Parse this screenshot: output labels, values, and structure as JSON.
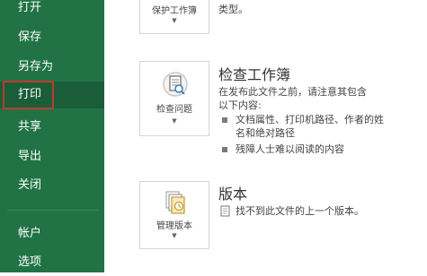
{
  "sidebar": {
    "items": [
      {
        "label": "打开"
      },
      {
        "label": "保存"
      },
      {
        "label": "另存为"
      },
      {
        "label": "打印"
      },
      {
        "label": "共享"
      },
      {
        "label": "导出"
      },
      {
        "label": "关闭"
      },
      {
        "label": "帐户"
      },
      {
        "label": "选项"
      }
    ],
    "active_item": "打印",
    "background": "#217346",
    "highlight_color": "#c0392b"
  },
  "protect": {
    "button_label": "保护工作簿",
    "desc_fragment": "类型。"
  },
  "inspect": {
    "title": "检查工作簿",
    "button_label": "检查问题",
    "desc_line1": "在发布此文件之前，请注意其包含",
    "desc_line2": "以下内容:",
    "bullets": [
      {
        "line1": "文档属性、打印机路径、作者的姓",
        "line2": "名和绝对路径"
      },
      {
        "line1": "残障人士难以阅读的内容",
        "line2": ""
      }
    ]
  },
  "versions": {
    "title": "版本",
    "button_label": "管理版本",
    "message": "找不到此文件的上一个版本。"
  },
  "icons": [
    "lock-icon",
    "inspect-document-icon",
    "manage-versions-icon",
    "document-small-icon"
  ]
}
